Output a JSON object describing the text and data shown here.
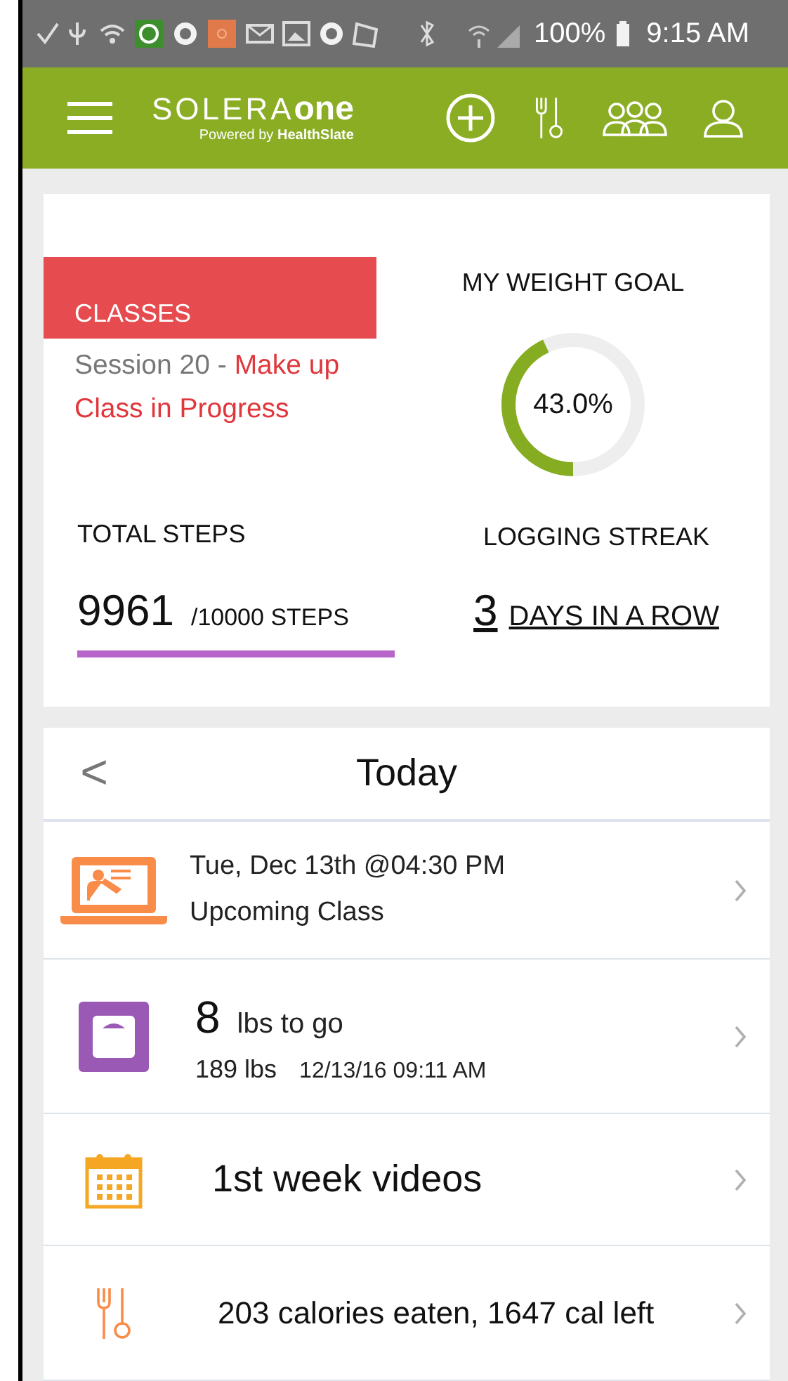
{
  "status_bar": {
    "battery": "100%",
    "time": "9:15 AM"
  },
  "header": {
    "logo_light": "SOLERA",
    "logo_bold": "one",
    "tagline_prefix": "Powered by",
    "tagline_brand": "HealthSlate"
  },
  "classes": {
    "title": "CLASSES",
    "session": "Session 20 - ",
    "status": "Make up Class in Progress"
  },
  "weight_goal": {
    "title": "MY WEIGHT GOAL",
    "level": 0.43,
    "reading": "43.0%"
  },
  "steps": {
    "title": "TOTAL STEPS",
    "count": "9961",
    "goal": "/10000 STEPS"
  },
  "streak": {
    "title": "LOGGING STREAK",
    "count": "3",
    "label": "DAYS IN A ROW"
  },
  "today": {
    "title": "Today",
    "back": "<"
  },
  "rows": [
    {
      "kind": "class",
      "line1": "Tue, Dec 13th @04:30 PM",
      "line2": "Upcoming Class"
    },
    {
      "kind": "weight",
      "big": "8",
      "line1": "lbs to go",
      "line2": "189 lbs",
      "line3": "12/13/16 09:11 AM"
    },
    {
      "kind": "videos",
      "line1": "1st week videos"
    },
    {
      "kind": "food",
      "line1": "203 calories eaten, 1647 cal left"
    }
  ]
}
